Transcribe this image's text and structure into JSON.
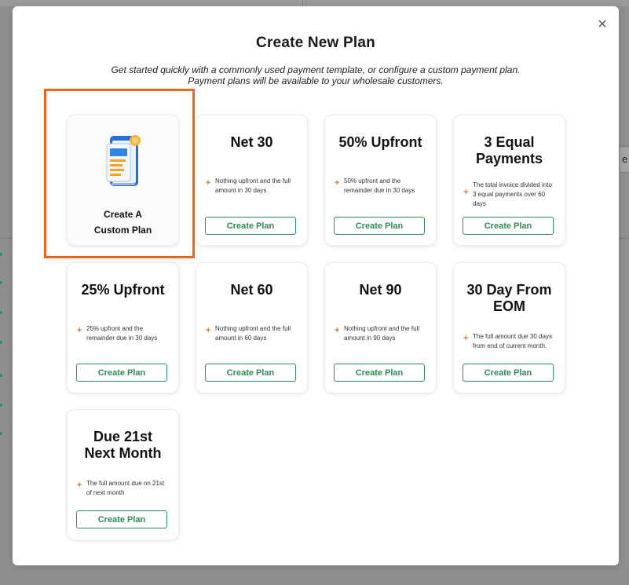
{
  "background": {
    "right_chip_text": "e N"
  },
  "modal": {
    "title": "Create New Plan",
    "subtitle": "Get started quickly with a commonly used payment template, or configure a custom payment plan. Payment plans will be available to your wholesale customers.",
    "close_glyph": "×",
    "custom_plan_line1": "Create A",
    "custom_plan_line2": "Custom Plan",
    "plus_glyph": "+",
    "plans": [
      {
        "title": "Net 30",
        "description": "Nothing upfront and the full amount in 30 days",
        "button": "Create Plan"
      },
      {
        "title": "50% Upfront",
        "description": "50% upfront and the remainder due in 30 days",
        "button": "Create Plan"
      },
      {
        "title": "3 Equal Payments",
        "description": "The total invoice divided into 3 equal payments over 60 days",
        "button": "Create Plan"
      },
      {
        "title": "25% Upfront",
        "description": "25% upfront and the remainder due in 30 days",
        "button": "Create Plan"
      },
      {
        "title": "Net 60",
        "description": "Nothing upfront and the full amount in 60 days",
        "button": "Create Plan"
      },
      {
        "title": "Net 90",
        "description": "Nothing upfront and the full amount in 90 days",
        "button": "Create Plan"
      },
      {
        "title": "30 Day From EOM",
        "description": "The full amount due 30 days from end of current month.",
        "button": "Create Plan"
      },
      {
        "title": "Due 21st Next Month",
        "description": "The full amount due on 21st of next month",
        "button": "Create Plan"
      }
    ]
  },
  "colors": {
    "accent_green": "#2e8b57",
    "highlight_orange": "#f06418",
    "plus_orange": "#e07a1a"
  }
}
